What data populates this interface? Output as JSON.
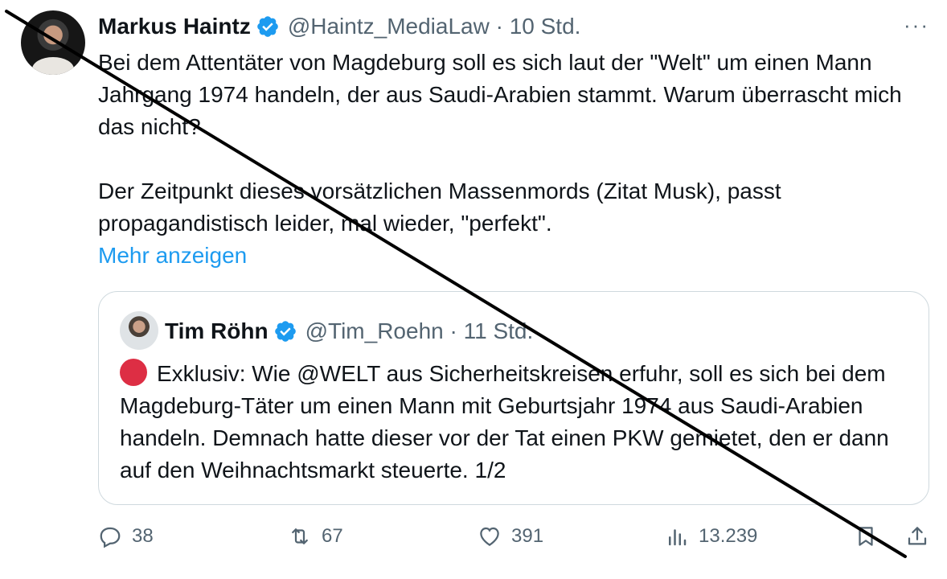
{
  "tweet": {
    "author_name": "Markus Haintz",
    "handle_time": "@Haintz_MediaLaw · 10 Std.",
    "more_icon": "···",
    "text_paragraphs": [
      "Bei dem Attentäter von Magdeburg soll es sich laut der \"Welt\" um einen Mann Jahrgang 1974 handeln, der aus Saudi-Arabien stammt. Warum überrascht mich das nicht?",
      "Der Zeitpunkt dieses vorsätzlichen Massenmords (Zitat Musk), passt propagandistisch leider, mal wieder, \"perfekt\"."
    ],
    "show_more": "Mehr anzeigen"
  },
  "quoted": {
    "author_name": "Tim Röhn",
    "handle_time": "@Tim_Roehn · 11 Std.",
    "text": "Exklusiv: Wie @WELT aus Sicherheitskreisen erfuhr, soll es sich bei dem Magdeburg-Täter um einen Mann mit Geburtsjahr 1974 aus Saudi-Arabien handeln. Demnach hatte dieser vor der Tat einen PKW gemietet, den er dann auf den Weihnachtsmarkt steuerte. 1/2"
  },
  "actions": {
    "replies": "38",
    "retweets": "67",
    "likes": "391",
    "views": "13.239"
  },
  "colors": {
    "verified": "#1d9bf0",
    "link": "#1d9bf0",
    "muted": "#536471",
    "border": "#cfd9de"
  }
}
